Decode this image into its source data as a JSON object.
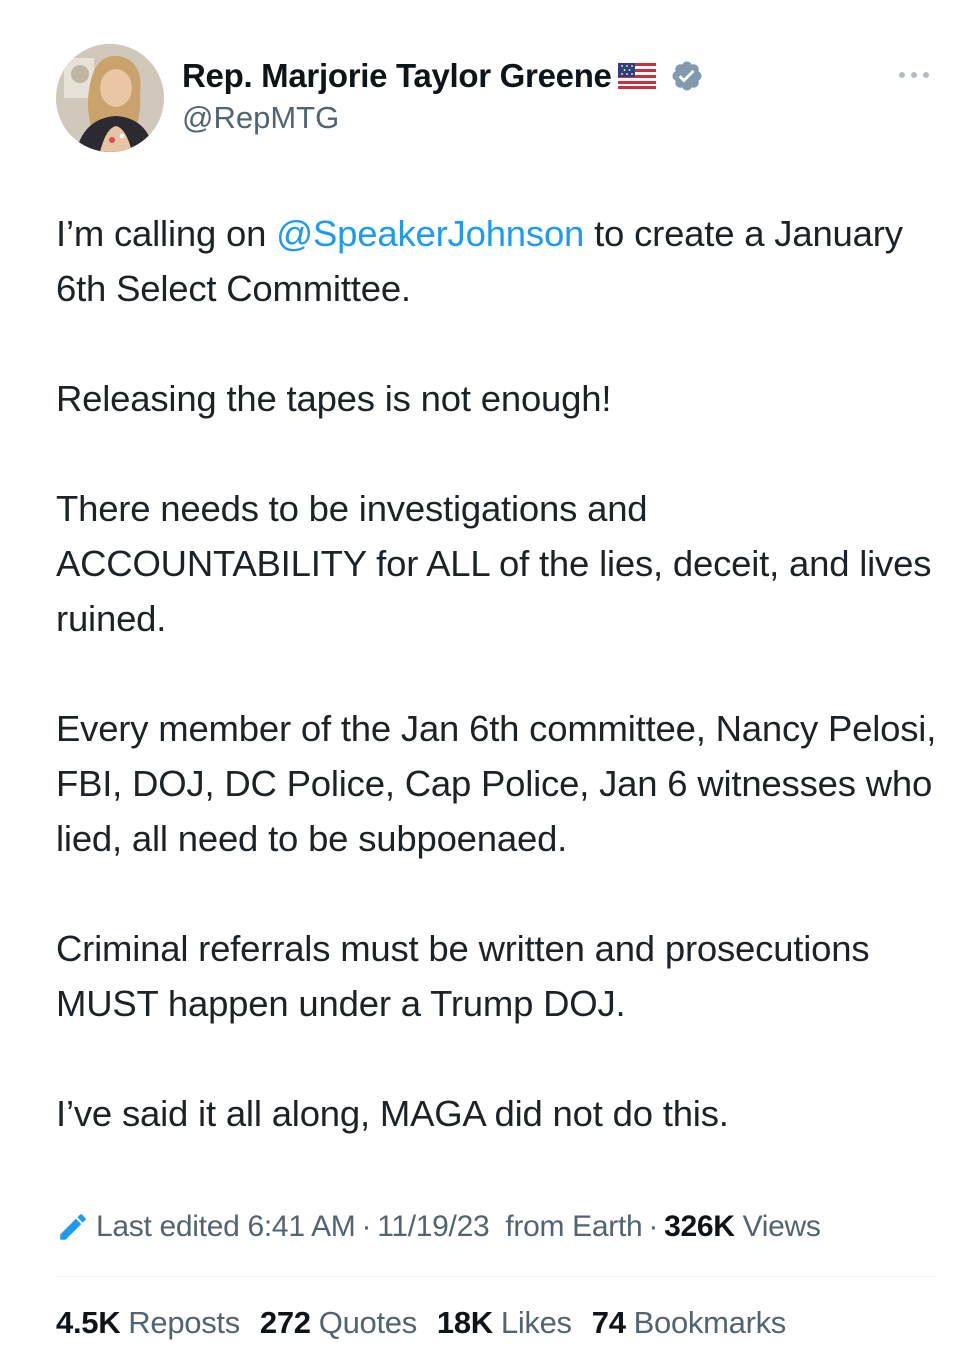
{
  "author": {
    "display_name": "Rep. Marjorie Taylor Greene",
    "handle": "@RepMTG",
    "flag_icon": "us-flag-icon",
    "verified_icon": "verified-badge-icon",
    "verified_color": "#829aab"
  },
  "tweet": {
    "p1_before": "I’m calling on ",
    "p1_mention": "@SpeakerJohnson",
    "p1_after": " to create a January 6th Select Committee.",
    "p2": "Releasing the tapes is not enough!",
    "p3": "There needs to be investigations and ACCOUNTABILITY for ALL of the lies, deceit, and lives ruined.",
    "p4": "Every member of the Jan 6th committee, Nancy Pelosi, FBI, DOJ, DC Police, Cap Police, Jan 6 witnesses who lied, all need to be subpoenaed.",
    "p5": "Criminal referrals must be written and prosecutions MUST happen under a Trump DOJ.",
    "p6": "I’ve said it all along, MAGA did not do this."
  },
  "meta": {
    "edited_label": "Last edited 6:41 AM",
    "date": "11/19/23",
    "location": "from Earth",
    "views_count": "326K",
    "views_label": "Views"
  },
  "stats": {
    "reposts_count": "4.5K",
    "reposts_label": "Reposts",
    "quotes_count": "272",
    "quotes_label": "Quotes",
    "likes_count": "18K",
    "likes_label": "Likes",
    "bookmarks_count": "74",
    "bookmarks_label": "Bookmarks"
  },
  "colors": {
    "link": "#1d9bf0",
    "secondary_text": "#536471",
    "primary_text": "#0f1419"
  }
}
